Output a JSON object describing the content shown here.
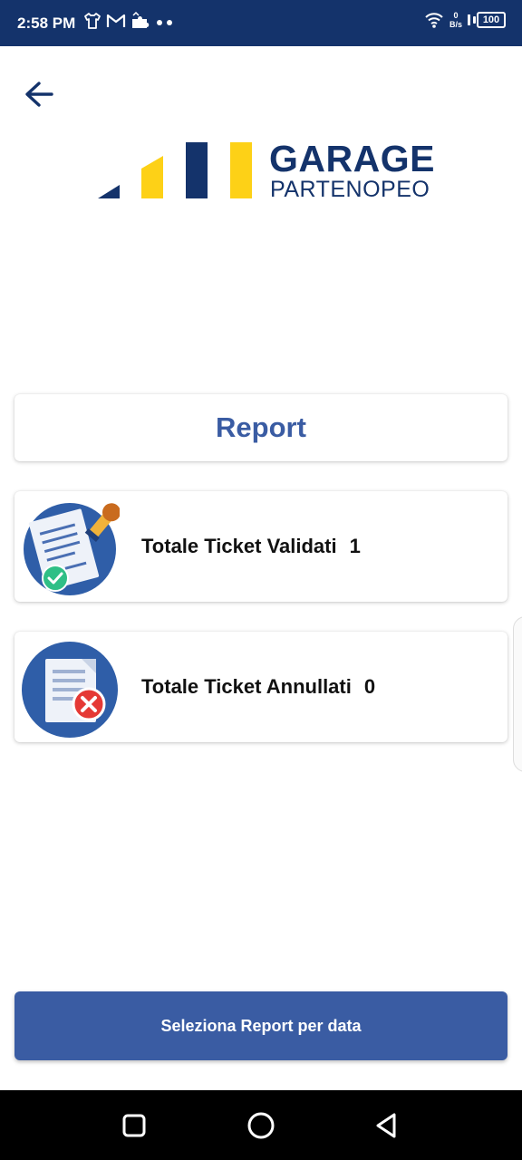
{
  "status_bar": {
    "time": "2:58 PM",
    "speed_value": "0",
    "speed_unit": "B/s",
    "battery": "100",
    "icons": [
      "shirt-icon",
      "gmail-icon",
      "puzzle-icon",
      "dots-icon",
      "wifi-icon",
      "signal-icon",
      "battery-icon"
    ]
  },
  "logo": {
    "line1": "GARAGE",
    "line2": "PARTENOPEO",
    "colors": {
      "navy": "#14336b",
      "yellow": "#fdd117"
    }
  },
  "report_header": "Report",
  "stats": [
    {
      "label": "Totale Ticket Validati",
      "value": "1",
      "icon": "validated-ticket-icon"
    },
    {
      "label": "Totale Ticket Annullati",
      "value": "0",
      "icon": "cancelled-ticket-icon"
    }
  ],
  "bottom_button": "Seleziona Report per data",
  "nav_bar": {
    "icons": [
      "recent-apps-icon",
      "home-icon",
      "back-nav-icon"
    ]
  },
  "colors": {
    "status_bar": "#14336b",
    "accent": "#3a5ca3",
    "text": "#111111",
    "nav_bar": "#000000"
  }
}
